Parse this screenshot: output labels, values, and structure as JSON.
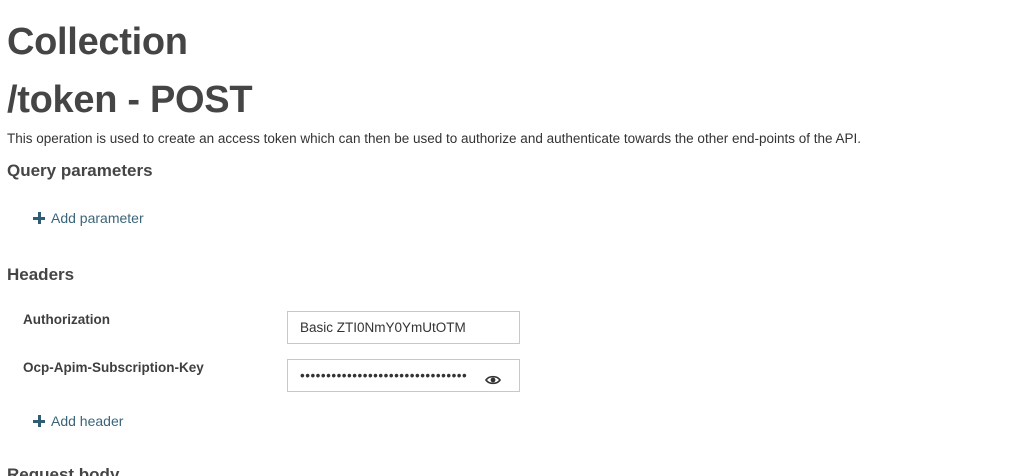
{
  "page": {
    "title": "Collection",
    "operation_title": "/token - POST",
    "description": "This operation is used to create an access token which can then be used to authorize and authenticate towards the other end-points of the API."
  },
  "query_parameters": {
    "title": "Query parameters",
    "add_label": "Add parameter"
  },
  "headers": {
    "title": "Headers",
    "items": [
      {
        "name": "Authorization",
        "value": "Basic ZTI0NmY0YmUtOTM",
        "type": "text"
      },
      {
        "name": "Ocp-Apim-Subscription-Key",
        "value": "••••••••••••••••••••••••••••••••",
        "type": "password"
      }
    ],
    "add_label": "Add header",
    "reveal_icon": "eye-icon"
  },
  "request_body": {
    "title": "Request body"
  },
  "colors": {
    "heading": "#454545",
    "link": "#3a6478",
    "field_border": "#c8c8c8"
  }
}
